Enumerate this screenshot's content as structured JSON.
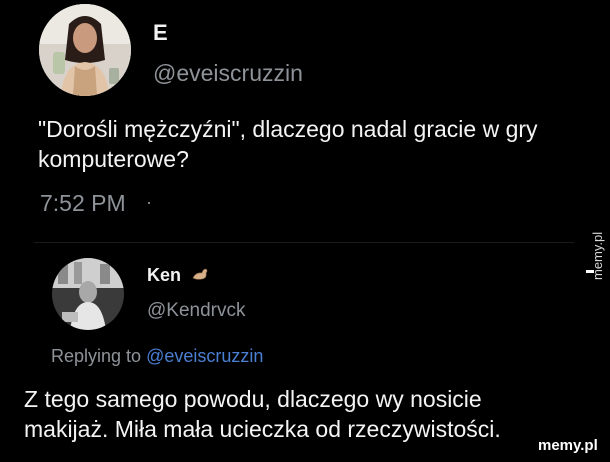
{
  "tweet": {
    "author_name": "E",
    "author_handle": "@eveiscruzzin",
    "text": "\"Dorośli mężczyźni\", dlaczego nadal gracie w gry komputerowe?",
    "time": "7:52 PM",
    "time_separator": "·"
  },
  "reply": {
    "author_name": "Ken",
    "author_handle": "@Kendrvck",
    "replying_label": "Replying to",
    "replying_mention": "@eveiscruzzin",
    "text": "Z tego samego powodu, dlaczego wy nosicie makijaż. Miła mała ucieczka od rzeczywistości."
  },
  "watermarks": {
    "side": "memy.pl",
    "bottom": "memy.pl"
  },
  "icons": {
    "reply_emoji": "flexed-arm-icon"
  },
  "colors": {
    "background": "#000000",
    "text": "#f4f4f4",
    "muted": "#8e9399",
    "mention": "#4b7fd1"
  }
}
